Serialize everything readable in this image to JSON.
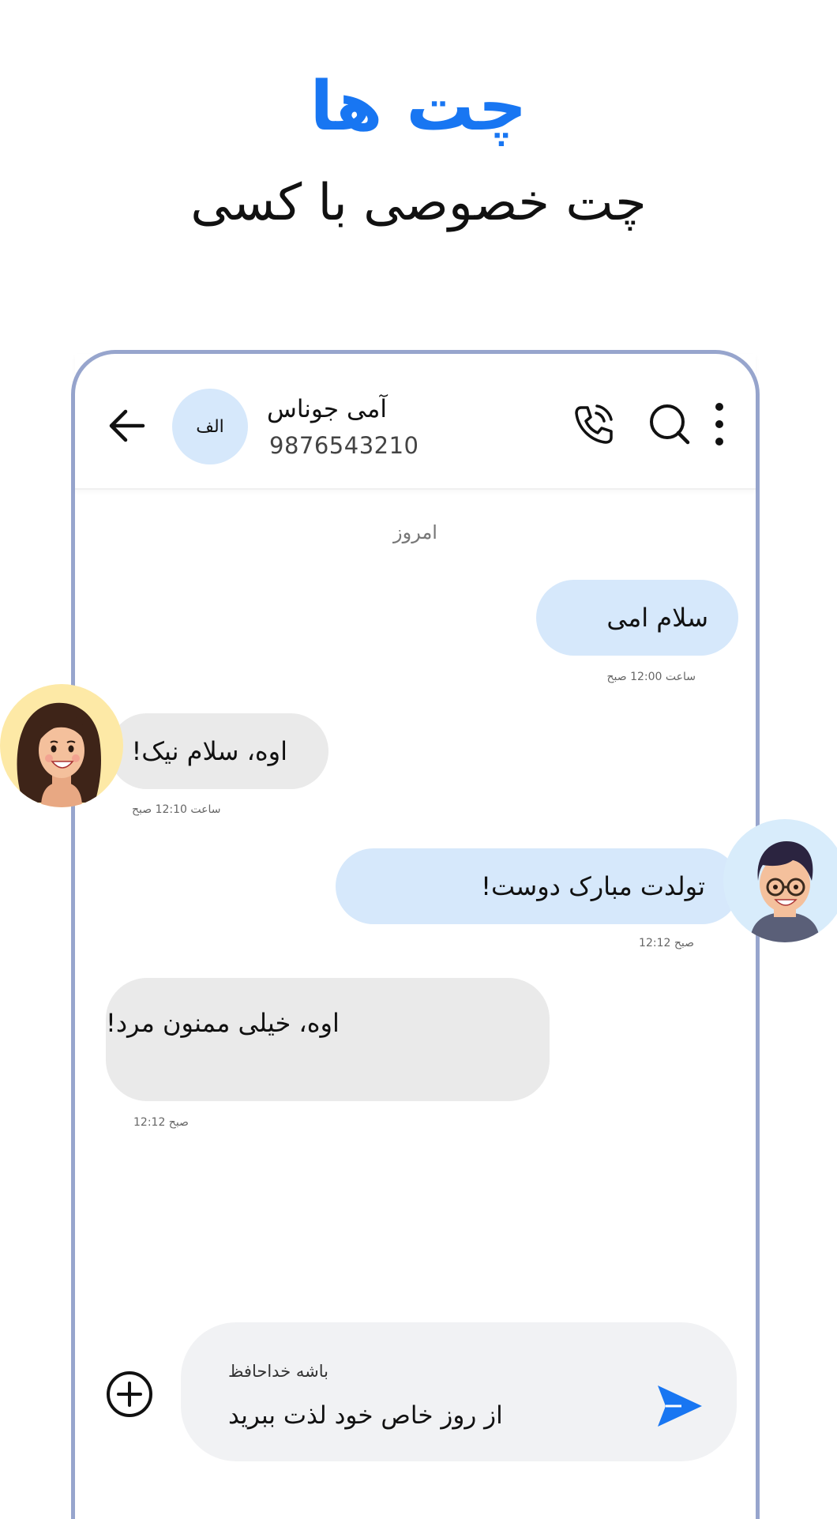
{
  "promo": {
    "title": "چت ها",
    "subtitle": "چت خصوصی با کسی"
  },
  "header": {
    "avatar_initials": "الف",
    "contact_name": "آمی جوناس",
    "contact_phone": "9876543210",
    "icons": [
      "back-arrow-icon",
      "phone-call-icon",
      "search-icon",
      "more-vertical-icon"
    ]
  },
  "chat": {
    "date_separator": "امروز",
    "messages": [
      {
        "direction": "out",
        "text": "سلام امی",
        "time": "ساعت 12:00 صبح"
      },
      {
        "direction": "in",
        "text": "اوه، سلام نیک!",
        "time": "ساعت 12:10 صبح"
      },
      {
        "direction": "out",
        "text": "تولدت مبارک دوست!",
        "time": "12:12 صبح"
      },
      {
        "direction": "in",
        "text": "اوه، خیلی ممنون مرد!",
        "time": "12:12 صبح"
      }
    ]
  },
  "composer": {
    "reply_label": "باشه خداحافظ",
    "message_text": "از روز خاص خود لذت ببرید",
    "icons": [
      "add-circle-icon",
      "send-icon"
    ]
  },
  "colors": {
    "accent": "#1876f2",
    "outgoing_bubble": "#d6e8fb",
    "incoming_bubble": "#eaeaea",
    "phone_frame": "#97a5cd"
  }
}
